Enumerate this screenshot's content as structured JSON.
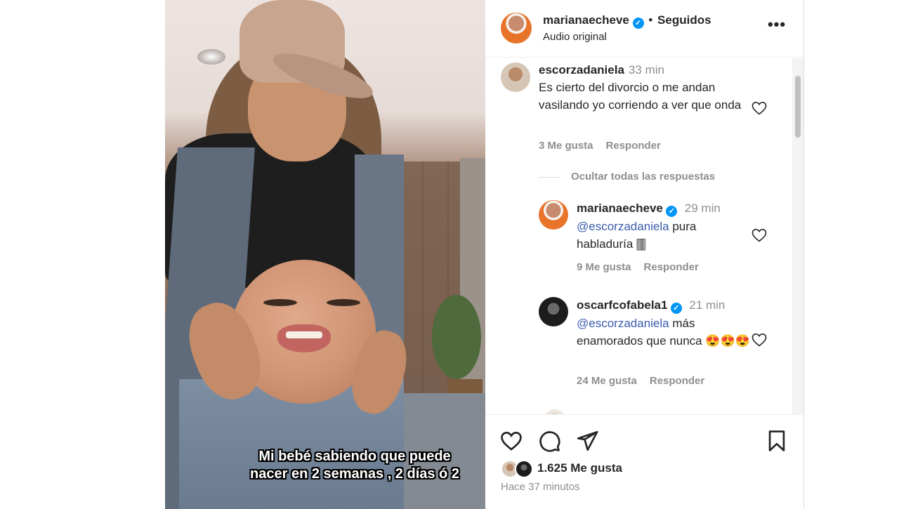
{
  "post": {
    "caption_overlay": "Mi bebé sabiendo que puede nacer en 2 semanas , 2 días ó 2"
  },
  "header": {
    "username": "marianaecheve",
    "separator": "•",
    "follow_status": "Seguidos",
    "audio": "Audio original",
    "more_icon": "more-horizontal-icon",
    "more_label": "•••"
  },
  "comments": [
    {
      "username": "escorzadaniela",
      "time": "33 min",
      "text": "Es cierto del divorcio o me andan vasilando yo corriendo a ver que onda",
      "likes": "3 Me gusta",
      "reply": "Responder"
    }
  ],
  "replies_toggle": "Ocultar todas las respuestas",
  "replies": [
    {
      "username": "marianaecheve",
      "verified": true,
      "time": "29 min",
      "mention": "@escorzadaniela",
      "text": " pura habladuría 🀫",
      "likes": "9 Me gusta",
      "reply": "Responder"
    },
    {
      "username": "oscarfcofabela1",
      "verified": true,
      "time": "21 min",
      "mention": "@escorzadaniela",
      "text": " más enamorados que nunca 😍😍😍",
      "likes": "24 Me gusta",
      "reply": "Responder"
    }
  ],
  "actions": {
    "likes_count": "1.625 Me gusta",
    "time_ago": "Hace 37 minutos"
  },
  "colors": {
    "verified": "#0095f6",
    "mention": "#3a5dae",
    "muted": "#8e8e8e",
    "text": "#262626"
  }
}
